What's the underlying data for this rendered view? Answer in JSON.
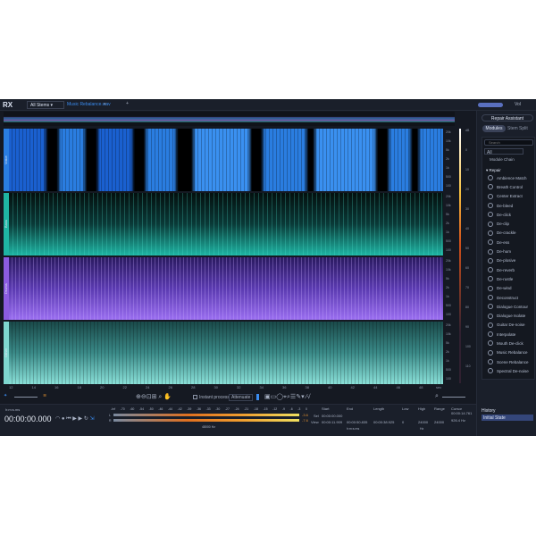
{
  "app": {
    "logo": "RX",
    "stems_dropdown": "All Stems",
    "file_tab": "Music Rebalance.wav",
    "add_tab": "+",
    "vol_label": "Vol"
  },
  "tracks": [
    {
      "label": "Voice",
      "color": "#2a7de0"
    },
    {
      "label": "Bass",
      "color": "#1fb5a4"
    },
    {
      "label": "Drums",
      "color": "#8b5ce0"
    },
    {
      "label": "Other",
      "color": "#7fd6cf"
    }
  ],
  "freq_labels": [
    "20k",
    "10k",
    "5k",
    "2k",
    "1k",
    "500",
    "100"
  ],
  "db_labels": [
    "dB",
    "0",
    "10",
    "20",
    "30",
    "40",
    "50",
    "60",
    "70",
    "80",
    "90",
    "100",
    "110"
  ],
  "ruler": {
    "ticks": [
      "12",
      "14",
      "16",
      "18",
      "20",
      "22",
      "24",
      "26",
      "28",
      "30",
      "32",
      "34",
      "36",
      "38",
      "40",
      "42",
      "44",
      "46",
      "48"
    ],
    "unit": "sec"
  },
  "toolbar": {
    "instant_process": "Instant process",
    "mode": "Attenuate"
  },
  "transport": {
    "format": "h:m:s.ms",
    "time": "00:00:00.000"
  },
  "levels": {
    "scale": [
      "-Inf",
      "-70",
      "-60",
      "-54",
      "-50",
      "-46",
      "-44",
      "-42",
      "-39",
      "-36",
      "-33",
      "-30",
      "-27",
      "-24",
      "-21",
      "-18",
      "-15",
      "-12",
      "-9",
      "-6",
      "-3",
      "0"
    ],
    "channels": [
      "L",
      "R"
    ],
    "peak_l": "-3.6",
    "peak_r": "-7.6",
    "sample_rate": "48000 Hz"
  },
  "selection": {
    "headers": [
      "Start",
      "End",
      "Length",
      "Low",
      "High",
      "Range",
      "Cursor"
    ],
    "sel_label": "Sel",
    "view_label": "View",
    "sel_start": "00:00:00.000",
    "view_start": "00:00:11.909",
    "view_end": "00:00:50.835",
    "view_length": "00:00:38.925",
    "low": "0",
    "high": "24000",
    "range": "24000",
    "cursor_time": "00:00:14.761",
    "cursor_freq": "926.4 Hz",
    "time_unit": "h:m:s.ms",
    "freq_unit": "Hz"
  },
  "right": {
    "repair_assistant": "Repair Assistant",
    "tabs": [
      "Modules",
      "Stem Split"
    ],
    "search_placeholder": "Search",
    "filter": "All",
    "module_chain": "Module Chain",
    "section": "Repair",
    "modules": [
      "Ambience Match",
      "Breath Control",
      "Center Extract",
      "De-bleed",
      "De-click",
      "De-clip",
      "De-crackle",
      "De-ess",
      "De-hum",
      "De-plosive",
      "De-reverb",
      "De-rustle",
      "De-wind",
      "Deconstruct",
      "Dialogue Contour",
      "Dialogue Isolate",
      "Guitar De-noise",
      "Interpolate",
      "Mouth De-click",
      "Music Rebalance",
      "Scene Rebalance",
      "Spectral De-noise"
    ],
    "history_title": "History",
    "history_items": [
      "Initial State"
    ]
  }
}
